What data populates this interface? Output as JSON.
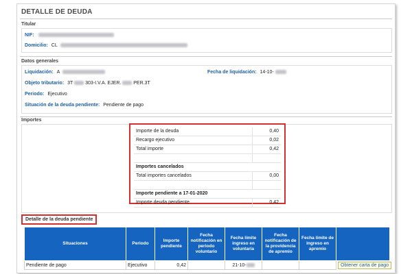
{
  "title": "DETALLE DE DEUDA",
  "titular": {
    "heading": "Titular",
    "nif_label": "NIF:",
    "domicilio_label": "Domicilio:",
    "domicilio_prefix": "CL"
  },
  "datos": {
    "heading": "Datos generales",
    "liquidacion_label": "Liquidación:",
    "liquidacion_prefix": "A",
    "fecha_liq_label": "Fecha de liquidación:",
    "fecha_liq_value": "14-10-",
    "objeto_label": "Objeto tributario:",
    "objeto_a": "3T",
    "objeto_b": "303-I.V.A. EJER.",
    "objeto_c": "PER.3T",
    "periodo_label": "Periodo:",
    "periodo_value": "Ejecutivo",
    "situacion_label": "Situación de la deuda pendiente:",
    "situacion_value": "Pendiente de pago"
  },
  "importes": {
    "heading": "Importes",
    "rows": [
      {
        "label": "Importe de la deuda",
        "value": "0,40"
      },
      {
        "label": "Recargo ejecutivo",
        "value": "0,02"
      },
      {
        "label": "Total importe",
        "value": "0,42"
      }
    ],
    "cancelados_heading": "Importes cancelados",
    "cancelados_label": "Total importes cancelados",
    "cancelados_value": "0,00",
    "pendiente_heading": "Importe pendiente a 17-01-2020",
    "pendiente_label": "Importe deuda pendiente",
    "pendiente_value": "0,42"
  },
  "detalle": {
    "label": "Detalle de la deuda pendiente",
    "headers": [
      "Situaciones",
      "Periodo",
      "Importe pendiente",
      "Fecha notificación en periodo voluntario",
      "Fecha límite ingreso en voluntaria",
      "Fecha notificación de la providencia de apremio",
      "Fecha límite de ingreso en apremio",
      ""
    ],
    "row": {
      "situacion": "Pendiente de pago",
      "periodo": "Ejecutivo",
      "importe": "0,42",
      "fecha_notif_vol": "",
      "fecha_limite_vol": "21-10-",
      "fecha_notif_apremio": "",
      "fecha_limite_apremio": "",
      "action_label": "Obtener carta de pago"
    }
  }
}
